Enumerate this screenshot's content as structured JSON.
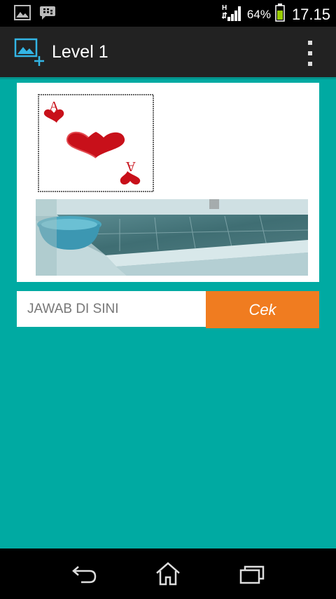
{
  "status_bar": {
    "battery_percent": "64%",
    "time": "17.15",
    "network_type": "H",
    "icons": [
      "gallery-icon",
      "bbm-icon",
      "signal-icon",
      "battery-icon"
    ]
  },
  "action_bar": {
    "title": "Level 1",
    "app_icon": "add-image-icon",
    "menu_icon": "overflow-menu-icon"
  },
  "puzzle": {
    "card_letter": "A",
    "images": [
      "ace-of-hearts-card",
      "bathroom-tub-photo"
    ]
  },
  "answer": {
    "placeholder": "JAWAB DI SINI",
    "value": "",
    "submit_label": "Cek"
  },
  "nav_bar": {
    "icons": [
      "back-icon",
      "home-icon",
      "recents-icon"
    ]
  },
  "colors": {
    "background": "#00aaa2",
    "button": "#f07c20",
    "action_bar": "#222222",
    "accent": "#33b5e5"
  }
}
